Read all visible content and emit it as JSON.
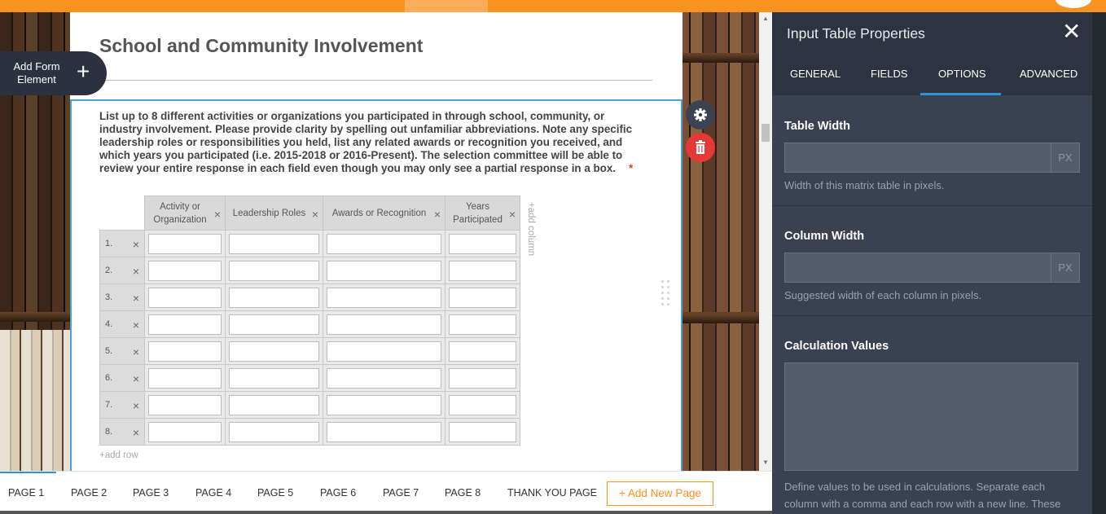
{
  "form": {
    "title": "School and Community Involvement",
    "question": "List up to 8 different activities or organizations you  participated in through school, community, or industry involvement. Please  provide clarity by spelling out unfamiliar abbreviations. Note any specific  leadership roles or responsibilities you held, list any related awards  or recognition you received, and which years you participated (i.e.  2015-2018 or 2016-Present). The selection committee will be able to review  your entire response in each field even though you may only see a partial response in a box.",
    "required_mark": "*",
    "table": {
      "columns": [
        "Activity or Organization",
        "Leadership Roles",
        "Awards or Recognition",
        "Years Participated"
      ],
      "rows": [
        "1.",
        "2.",
        "3.",
        "4.",
        "5.",
        "6.",
        "7.",
        "8."
      ],
      "remove_glyph": "×"
    },
    "add_column": "+add column",
    "add_row": "+add row"
  },
  "add_element": {
    "label": "Add Form Element",
    "plus": "+"
  },
  "pages": {
    "tabs": [
      "PAGE 1",
      "PAGE 2",
      "PAGE 3",
      "PAGE 4",
      "PAGE 5",
      "PAGE 6",
      "PAGE 7",
      "PAGE 8",
      "THANK YOU PAGE"
    ],
    "active": "PAGE 1",
    "add_new": "+ Add New Page"
  },
  "panel": {
    "title": "Input Table Properties",
    "close": "✕",
    "tabs": [
      "GENERAL",
      "FIELDS",
      "OPTIONS",
      "ADVANCED"
    ],
    "active_tab": "OPTIONS",
    "table_width": {
      "label": "Table Width",
      "value": "",
      "unit": "PX",
      "hint": "Width of this matrix table in pixels."
    },
    "column_width": {
      "label": "Column Width",
      "value": "",
      "unit": "PX",
      "hint": "Suggested width of each column in pixels."
    },
    "calculation_values": {
      "label": "Calculation Values",
      "value": "",
      "hint": "Define values to be used in calculations. Separate each column with a comma and each row with a new line. These"
    }
  },
  "icons": {
    "gear": "gear-icon",
    "trash": "trash-icon",
    "drag": "drag-handle-icon",
    "close": "close-icon"
  },
  "colors": {
    "accent_orange": "#f7931e",
    "accent_blue": "#2b95d6",
    "delete_red": "#e53935",
    "panel_bg": "#2d3340"
  }
}
